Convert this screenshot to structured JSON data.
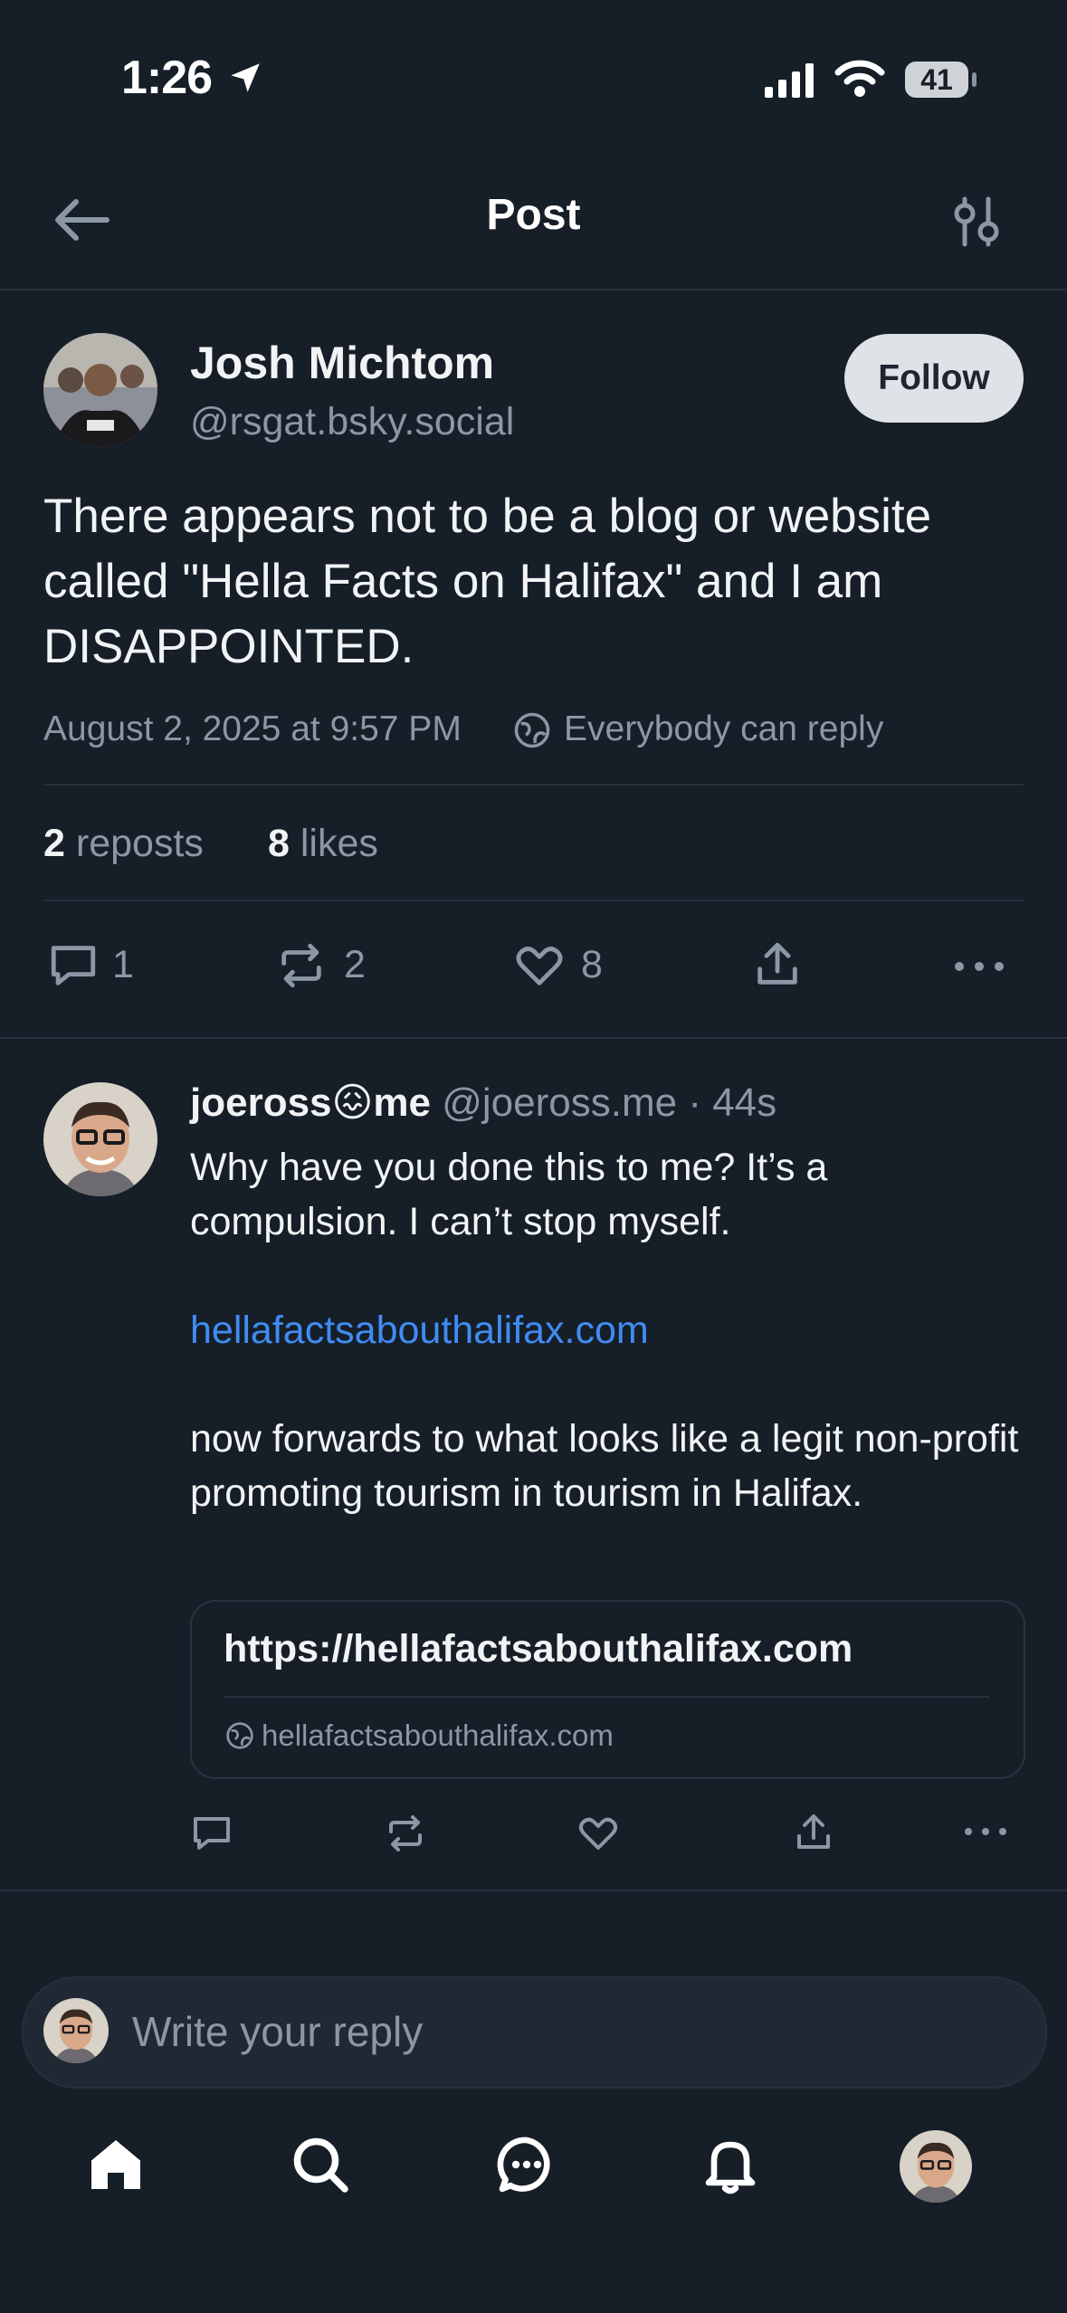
{
  "status_bar": {
    "time": "1:26",
    "battery": "41"
  },
  "header": {
    "title": "Post"
  },
  "post": {
    "author_name": "Josh Michtom",
    "author_handle": "@rsgat.bsky.social",
    "follow_label": "Follow",
    "text": "There appears not to be a blog or website called \"Hella Facts on Halifax\" and I am DISAPPOINTED.",
    "timestamp": "August 2, 2025 at 9:57 PM",
    "reply_setting": "Everybody can reply",
    "reposts_count": "2",
    "reposts_label": "reposts",
    "likes_count": "8",
    "likes_label": "likes",
    "actions": {
      "replies": "1",
      "reposts": "2",
      "likes": "8"
    }
  },
  "reply": {
    "name_part1": "joeross",
    "name_emoji": "😖",
    "name_part2": "me",
    "handle": "@joeross.me",
    "time": "· 44s",
    "text_line1": "Why have you done this to me? It’s a compulsion. I can’t stop myself.",
    "link": "hellafactsabouthalifax.com",
    "text_line2": "now forwards to what looks like a legit non-profit promoting tourism in tourism in Halifax.",
    "embed_title": "https://hellafactsabouthalifax.com",
    "embed_domain": "hellafactsabouthalifax.com"
  },
  "composer": {
    "placeholder": "Write your reply"
  },
  "colors": {
    "background": "#161e27",
    "link": "#3f8cf3",
    "muted": "#8b97a5",
    "divider": "#262f3a"
  }
}
